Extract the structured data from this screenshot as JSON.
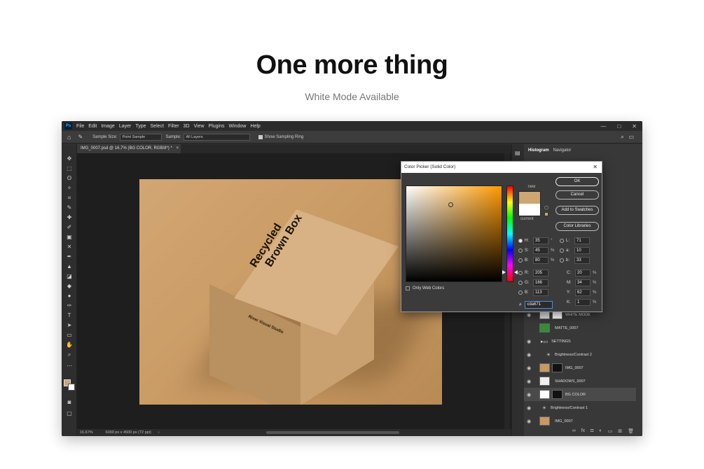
{
  "hero": {
    "title": "One more thing",
    "subtitle": "White Mode Available"
  },
  "app": {
    "logo": "Ps",
    "menu": [
      "File",
      "Edit",
      "Image",
      "Layer",
      "Type",
      "Select",
      "Filter",
      "3D",
      "View",
      "Plugins",
      "Window",
      "Help"
    ],
    "window_controls": [
      "—",
      "□",
      "✕"
    ]
  },
  "options_bar": {
    "sample_size_label": "Sample Size:",
    "sample_size_value": "Point Sample",
    "sample_label": "Sample:",
    "sample_value": "All Layers",
    "show_ring_label": "Show Sampling Ring"
  },
  "document": {
    "tab_title": "IMG_0007.psd @ 16,7% (BG COLOR, RGB/8*) *",
    "zoom": "16,67%",
    "size": "6000 px x 4500 px (72 ppi)",
    "box_text_line1": "Recycled",
    "box_text_line2": "Brown Box",
    "box_studio": "River Visual Studio"
  },
  "panels": {
    "tab_histogram": "Histogram",
    "tab_navigator": "Navigator",
    "layers": [
      {
        "name": "WHITE MODE",
        "kind": "mask"
      },
      {
        "name": "MATTE_0007",
        "kind": "plain"
      },
      {
        "name": "SETTINGS",
        "kind": "group"
      },
      {
        "name": "Brightness/Contrast 2",
        "kind": "adjust"
      },
      {
        "name": "IMG_0007",
        "kind": "mask"
      },
      {
        "name": "SHADOWS_0007",
        "kind": "plain"
      },
      {
        "name": "BG COLOR",
        "kind": "mask",
        "selected": true
      },
      {
        "name": "Brightness/Contrast 1",
        "kind": "adjust"
      },
      {
        "name": "IMG_0007",
        "kind": "plain"
      }
    ]
  },
  "color_picker": {
    "title": "Color Picker (Solid Color)",
    "new_label": "new",
    "current_label": "current",
    "new_color": "#cda671",
    "current_color": "#ffffff",
    "ok": "OK",
    "cancel": "Cancel",
    "add_swatches": "Add to Swatches",
    "color_libraries": "Color Libraries",
    "only_web_colors": "Only Web Colors",
    "hsb": [
      {
        "label": "H:",
        "value": "35",
        "unit": "°"
      },
      {
        "label": "S:",
        "value": "45",
        "unit": "%"
      },
      {
        "label": "B:",
        "value": "80",
        "unit": "%"
      }
    ],
    "rgb": [
      {
        "label": "R:",
        "value": "205"
      },
      {
        "label": "G:",
        "value": "166"
      },
      {
        "label": "B:",
        "value": "113"
      }
    ],
    "lab": [
      {
        "label": "L:",
        "value": "71"
      },
      {
        "label": "a:",
        "value": "10"
      },
      {
        "label": "b:",
        "value": "33"
      }
    ],
    "cmyk": [
      {
        "label": "C:",
        "value": "20",
        "unit": "%"
      },
      {
        "label": "M:",
        "value": "34",
        "unit": "%"
      },
      {
        "label": "Y:",
        "value": "62",
        "unit": "%"
      },
      {
        "label": "K:",
        "value": "1",
        "unit": "%"
      }
    ],
    "hex_label": "#",
    "hex": "cda671"
  }
}
